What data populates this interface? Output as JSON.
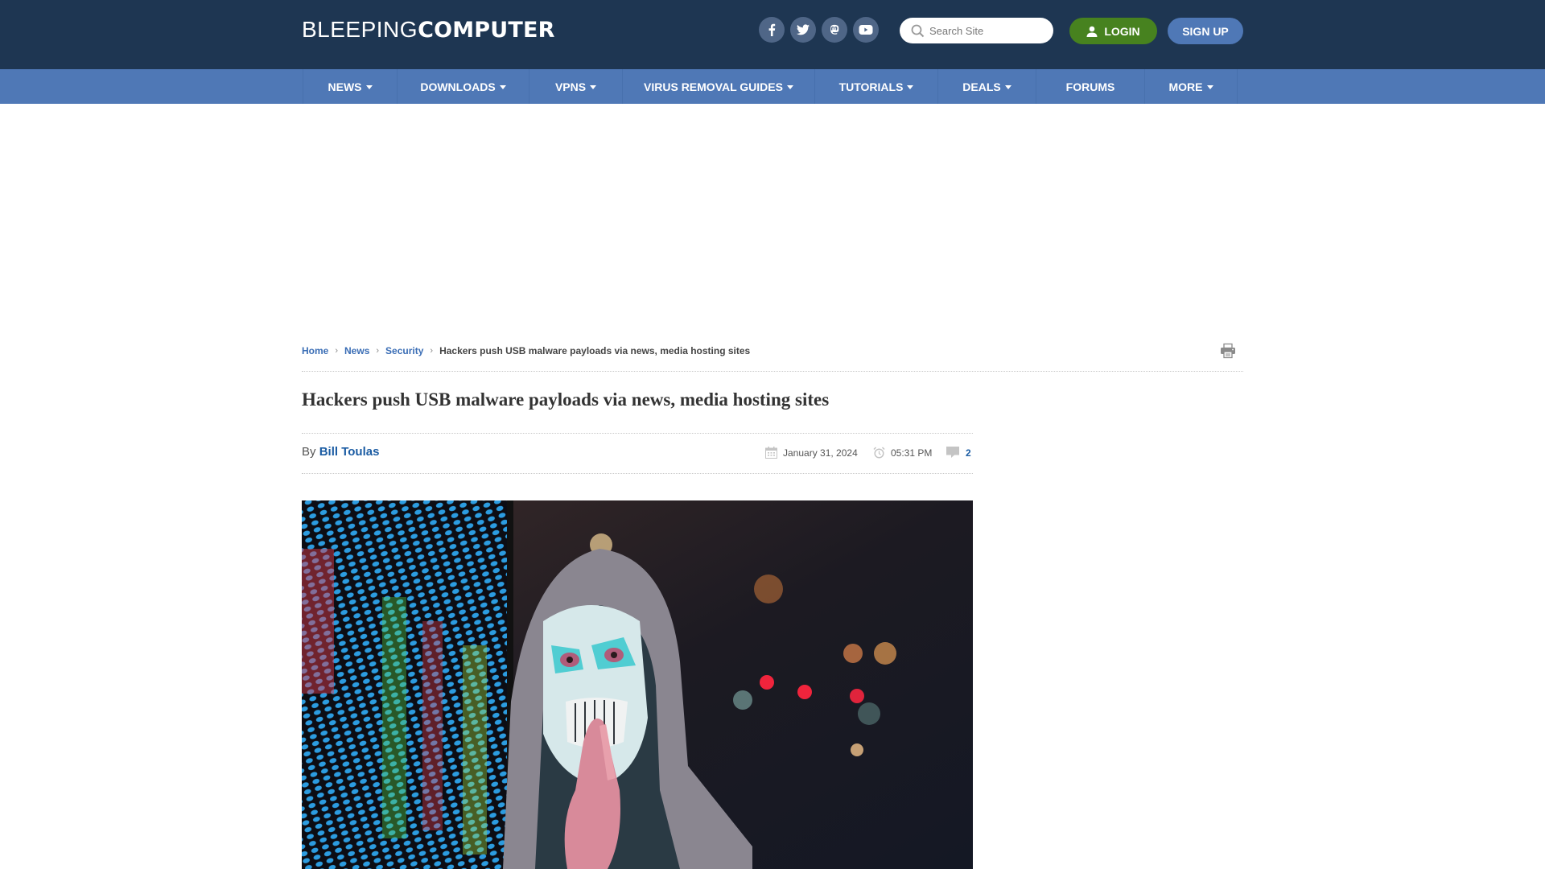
{
  "header": {
    "logo_light": "BLEEPING",
    "logo_bold": "COMPUTER",
    "social": [
      {
        "icon": "facebook-icon"
      },
      {
        "icon": "twitter-icon"
      },
      {
        "icon": "mastodon-icon"
      },
      {
        "icon": "youtube-icon"
      }
    ],
    "search_placeholder": "Search Site",
    "login_label": "LOGIN",
    "signup_label": "SIGN UP",
    "colors": {
      "header_bg": "#1e3652",
      "nav_bg": "#4f78b6",
      "login_bg": "#47821f",
      "signup_bg": "#4f78b6"
    }
  },
  "nav": {
    "items": [
      {
        "label": "NEWS",
        "dropdown": true
      },
      {
        "label": "DOWNLOADS",
        "dropdown": true
      },
      {
        "label": "VPNS",
        "dropdown": true
      },
      {
        "label": "VIRUS REMOVAL GUIDES",
        "dropdown": true
      },
      {
        "label": "TUTORIALS",
        "dropdown": true
      },
      {
        "label": "DEALS",
        "dropdown": true
      },
      {
        "label": "FORUMS",
        "dropdown": false
      },
      {
        "label": "MORE",
        "dropdown": true
      }
    ]
  },
  "breadcrumb": {
    "items": [
      "Home",
      "News",
      "Security"
    ],
    "current": "Hackers push USB malware payloads via news, media hosting sites"
  },
  "article": {
    "title": "Hackers push USB malware payloads via news, media hosting sites",
    "by_label": "By",
    "author": "Bill Toulas",
    "date": "January 31, 2024",
    "time": "05:31 PM",
    "comments": "2",
    "hero_alt": "Hooded person wearing a skull mask in front of colorful LED display"
  }
}
